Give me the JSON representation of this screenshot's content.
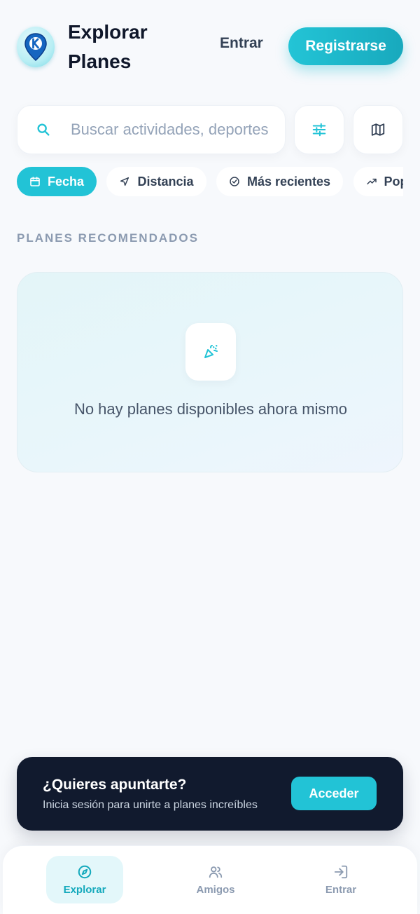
{
  "header": {
    "title": "Explorar Planes",
    "login_label": "Entrar",
    "register_label": "Registrarse",
    "logo_icon": "location-pin-k-icon"
  },
  "search": {
    "placeholder": "Buscar actividades, deportes",
    "search_icon": "search-icon",
    "filters_icon": "sliders-icon",
    "map_icon": "map-icon"
  },
  "chips": [
    {
      "label": "Fecha",
      "icon": "calendar-icon",
      "active": true
    },
    {
      "label": "Distancia",
      "icon": "navigation-icon",
      "active": false
    },
    {
      "label": "Más recientes",
      "icon": "badge-check-icon",
      "active": false
    },
    {
      "label": "Populares",
      "icon": "trending-up-icon",
      "active": false
    }
  ],
  "section": {
    "label": "PLANES RECOMENDADOS"
  },
  "empty_state": {
    "icon": "party-popper-icon",
    "message": "No hay planes disponibles ahora mismo"
  },
  "cta": {
    "title": "¿Quieres apuntarte?",
    "subtitle": "Inicia sesión para unirte a planes increíbles",
    "button_label": "Acceder"
  },
  "bottom_nav": [
    {
      "label": "Explorar",
      "icon": "compass-icon",
      "active": true
    },
    {
      "label": "Amigos",
      "icon": "users-icon",
      "active": false
    },
    {
      "label": "Entrar",
      "icon": "log-in-icon",
      "active": false
    }
  ],
  "colors": {
    "accent": "#22c3d6",
    "dark": "#111a2e",
    "background": "#f7f9fc"
  }
}
